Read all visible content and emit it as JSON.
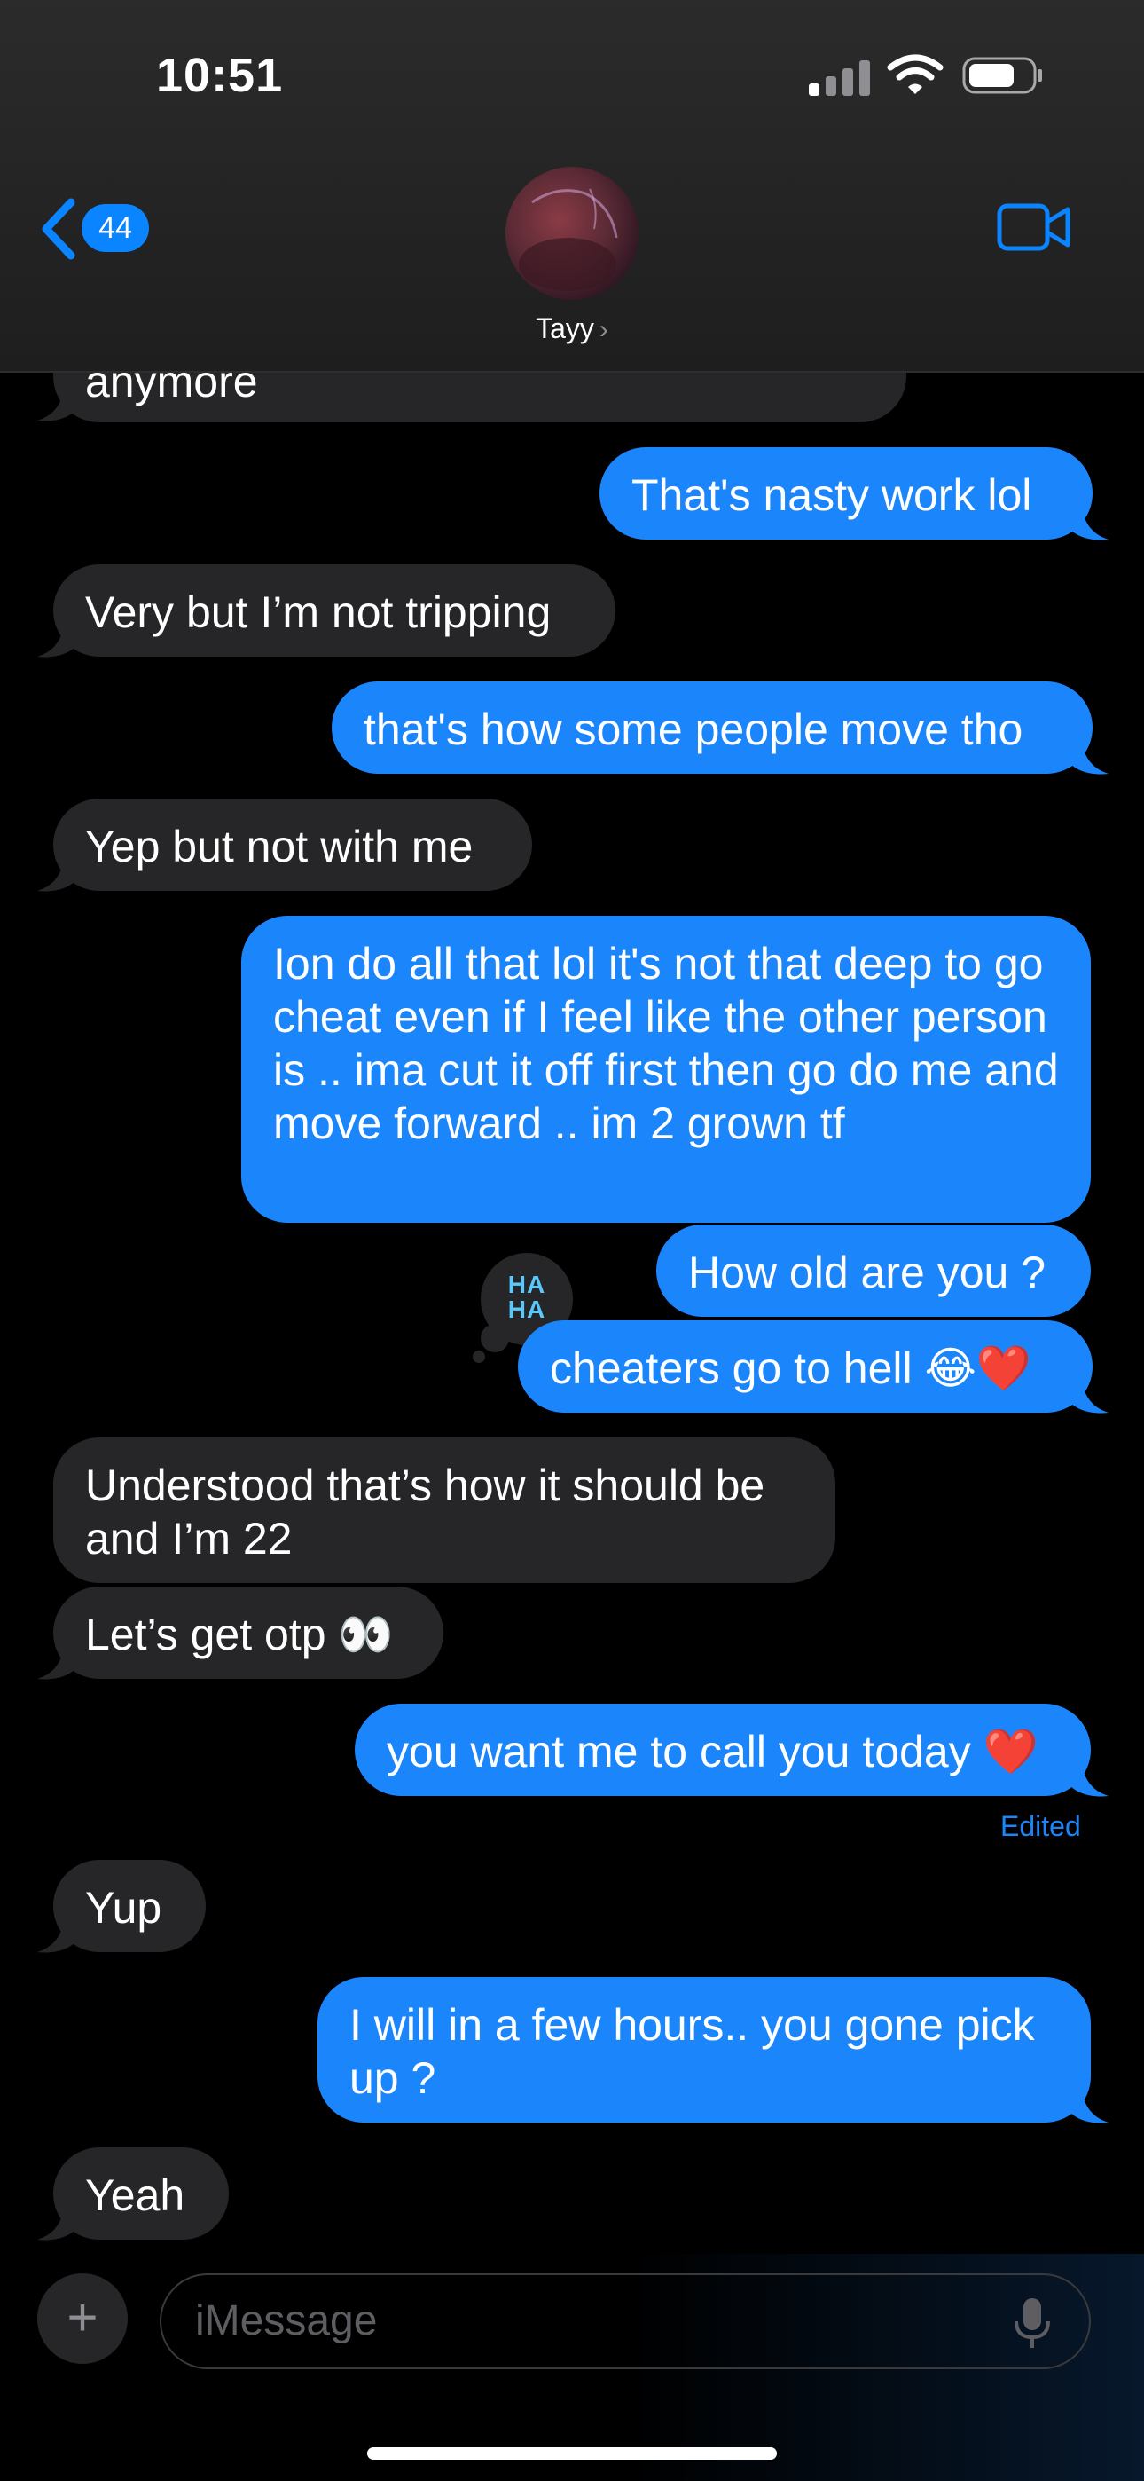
{
  "status": {
    "time": "10:51"
  },
  "header": {
    "back_count": "44",
    "contact": "Tayy",
    "contact_chevron": "›"
  },
  "messages": [
    {
      "text": "anymore"
    },
    {
      "text": "That's nasty work lol"
    },
    {
      "text": "Very but I’m not tripping"
    },
    {
      "text": "that's how some people move tho"
    },
    {
      "text": "Yep but not with me"
    },
    {
      "text": "Ion do all that lol  it's not that deep to go cheat even if I feel like the other person is .. ima cut it off first then go do me and move forward .. im 2 grown tf"
    },
    {
      "text": "How old are you ?"
    },
    {
      "text": "cheaters go to hell 😂❤️"
    },
    {
      "text": "Understood that’s how it should be and I’m 22"
    },
    {
      "text": "Let’s get otp 👀"
    },
    {
      "text": "you want me to call you today ❤️"
    },
    {
      "text": "Yup"
    },
    {
      "text": "I will in a few hours.. you gone pick up ?"
    },
    {
      "text": "Yeah"
    }
  ],
  "tapback": {
    "label_top": "HA",
    "label_bottom": "HA"
  },
  "edited_label": "Edited",
  "input": {
    "placeholder": "iMessage",
    "plus": "+"
  },
  "colors": {
    "outgoing": "#1b86fb",
    "incoming": "#262628",
    "background": "#000000",
    "accent": "#0a84ff"
  },
  "icons": [
    "signal-icon",
    "wifi-icon",
    "battery-icon",
    "back-chevron-icon",
    "video-camera-icon",
    "haha-tapback-icon",
    "plus-icon",
    "microphone-icon"
  ]
}
